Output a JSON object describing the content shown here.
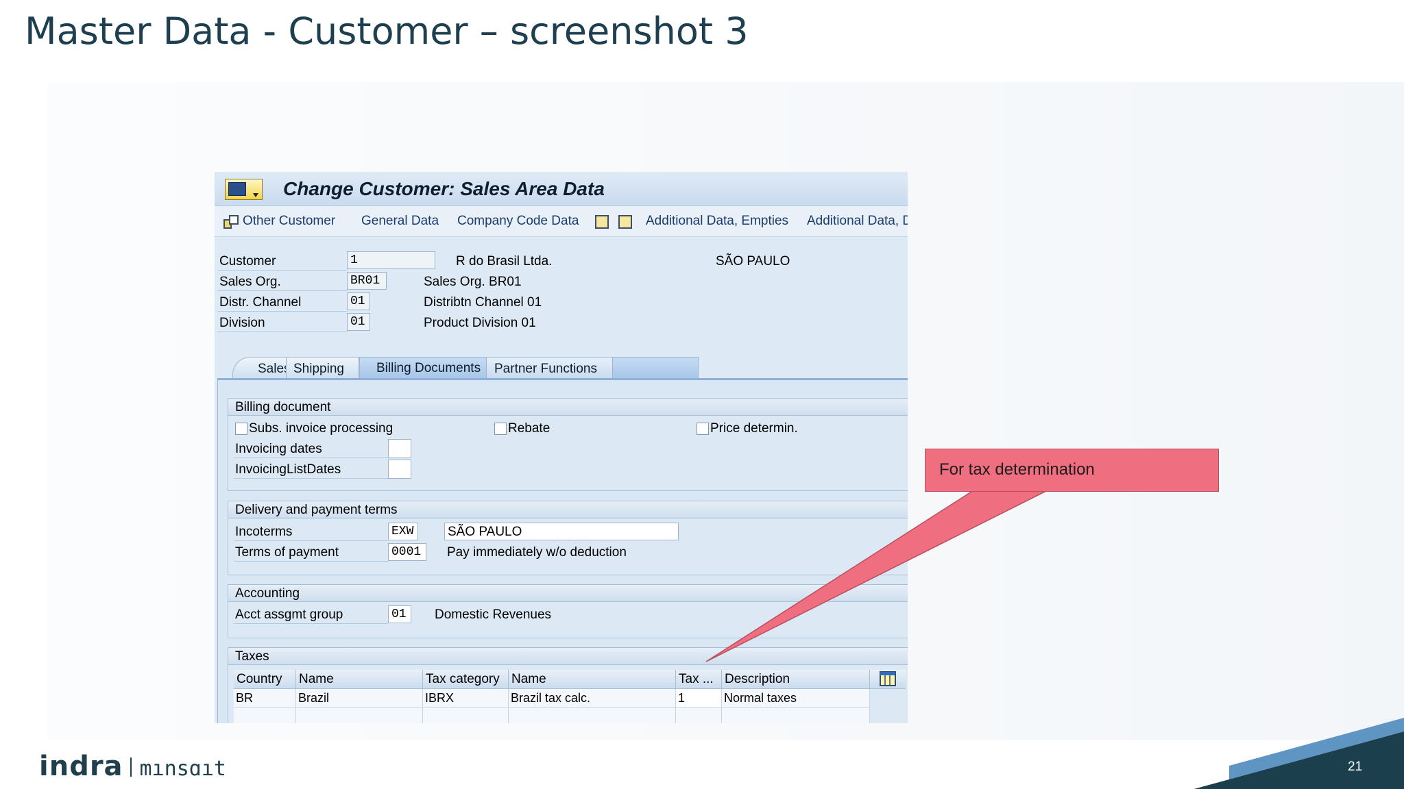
{
  "slide": {
    "title": "Master Data - Customer – screenshot 3",
    "page_number": "21"
  },
  "sap": {
    "title": "Change Customer: Sales Area Data",
    "toolbar": {
      "other_customer": "Other Customer",
      "general_data": "General Data",
      "company_code_data": "Company Code Data",
      "additional_data_empties": "Additional Data, Empties",
      "additional_data_d": "Additional Data, D"
    },
    "header": {
      "customer_label": "Customer",
      "customer_value": "1",
      "customer_name": "R do Brasil Ltda.",
      "customer_city": "SÃO PAULO",
      "sales_org_label": "Sales Org.",
      "sales_org_value": "BR01",
      "sales_org_text": "Sales Org. BR01",
      "distr_channel_label": "Distr. Channel",
      "distr_channel_value": "01",
      "distr_channel_text": "Distribtn Channel 01",
      "division_label": "Division",
      "division_value": "01",
      "division_text": "Product Division 01"
    },
    "tabs": [
      "Sales",
      "Shipping",
      "Billing Documents",
      "Partner Functions"
    ],
    "billing": {
      "title": "Billing document",
      "subs_invoice": "Subs. invoice processing",
      "rebate": "Rebate",
      "price_determin": "Price determin.",
      "invoicing_dates": "Invoicing dates",
      "invoicing_list_dates": "InvoicingListDates"
    },
    "delivery": {
      "title": "Delivery and payment terms",
      "incoterms_label": "Incoterms",
      "incoterms_value": "EXW",
      "incoterms_place": "SÃO PAULO",
      "terms_label": "Terms of payment",
      "terms_value": "0001",
      "terms_text": "Pay immediately w/o deduction"
    },
    "accounting": {
      "title": "Accounting",
      "acct_label": "Acct assgmt group",
      "acct_value": "01",
      "acct_text": "Domestic Revenues"
    },
    "taxes": {
      "title": "Taxes",
      "columns": [
        "Country",
        "Name",
        "Tax category",
        "Name",
        "Tax ...",
        "Description"
      ],
      "rows": [
        [
          "BR",
          "Brazil",
          "IBRX",
          "Brazil tax calc.",
          "1",
          "Normal taxes"
        ]
      ]
    }
  },
  "callout": {
    "text": "For tax determination"
  },
  "logo": {
    "brand": "indra",
    "sub_brand": "mınsɑıt"
  },
  "colors": {
    "title": "#1d3f4f",
    "callout": "#ef6f81",
    "sap_background": "#dde9f5",
    "corner_dark": "#1c3f4e",
    "corner_blue": "#5f95c2"
  },
  "icons": [
    "customer-menu-icon",
    "other-customer-icon",
    "save-data-icon",
    "copy-data-icon",
    "column-config-icon"
  ]
}
